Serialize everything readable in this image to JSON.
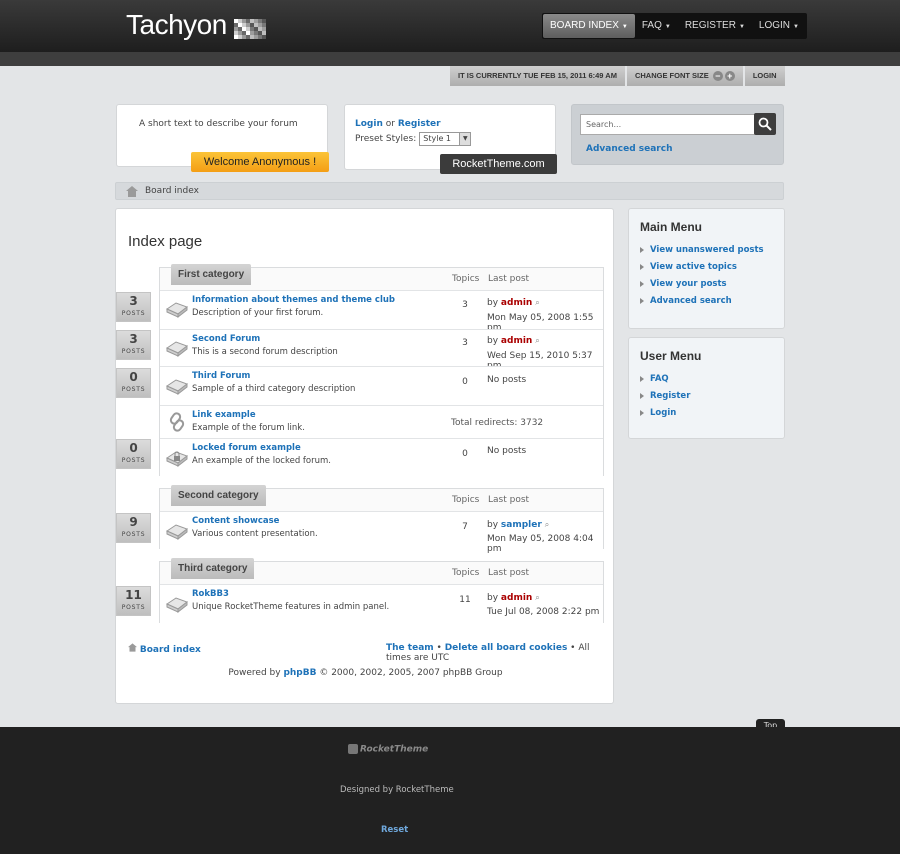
{
  "header": {
    "logo": "Tachyon",
    "nav": [
      {
        "label": "BOARD INDEX",
        "active": true
      },
      {
        "label": "FAQ",
        "active": false
      },
      {
        "label": "REGISTER",
        "active": false
      },
      {
        "label": "LOGIN",
        "active": false
      }
    ]
  },
  "utility": {
    "time_text": "IT IS CURRENTLY TUE FEB 15, 2011 6:49 AM",
    "font_size_label": "CHANGE FONT SIZE",
    "login_label": "LOGIN"
  },
  "intro": {
    "description": "A short text to describe your forum",
    "welcome": "Welcome Anonymous !"
  },
  "login_box": {
    "login_link": "Login",
    "or_text": "or",
    "register_link": "Register",
    "preset_label": "Preset Styles:",
    "preset_value": "Style 1",
    "badge": "RocketTheme.com"
  },
  "search": {
    "placeholder": "Search...",
    "advanced": "Advanced search"
  },
  "breadcrumb": {
    "label": "Board index"
  },
  "page_title": "Index page",
  "headers": {
    "topics": "Topics",
    "last_post": "Last post"
  },
  "labels": {
    "posts": "POSTS",
    "by": "by",
    "no_posts": "No posts",
    "total_redirects": "Total redirects:"
  },
  "categories": [
    {
      "name": "First category",
      "forums": [
        {
          "title": "Information about themes and theme club",
          "desc": "Description of your first forum.",
          "posts": "3",
          "topics": "3",
          "user": "admin",
          "date": "Mon May 05, 2008 1:55 pm"
        },
        {
          "title": "Second Forum",
          "desc": "This is a second forum description",
          "posts": "3",
          "topics": "3",
          "user": "admin",
          "date": "Wed Sep 15, 2010 5:37 pm"
        },
        {
          "title": "Third Forum",
          "desc": "Sample of a third category description",
          "posts": "0",
          "topics": "0"
        },
        {
          "title": "Link example",
          "desc": "Example of the forum link.",
          "redirects": "3732"
        },
        {
          "title": "Locked forum example",
          "desc": "An example of the locked forum.",
          "posts": "0",
          "topics": "0"
        }
      ]
    },
    {
      "name": "Second category",
      "forums": [
        {
          "title": "Content showcase",
          "desc": "Various content presentation.",
          "posts": "9",
          "topics": "7",
          "user": "sampler",
          "date": "Mon May 05, 2008 4:04 pm"
        }
      ]
    },
    {
      "name": "Third category",
      "forums": [
        {
          "title": "RokBB3",
          "desc": "Unique RocketTheme features in admin panel.",
          "posts": "11",
          "topics": "11",
          "user": "admin",
          "date": "Tue Jul 08, 2008 2:22 pm"
        }
      ]
    }
  ],
  "page_footer": {
    "home": "Board index",
    "team": "The team",
    "delete_cookies": "Delete all board cookies",
    "timezone": "All times are UTC",
    "powered_prefix": "Powered by",
    "powered_link": "phpBB",
    "powered_suffix": "© 2000, 2002, 2005, 2007 phpBB Group"
  },
  "main_menu": {
    "title": "Main Menu",
    "items": [
      "View unanswered posts",
      "View active topics",
      "View your posts",
      "Advanced search"
    ]
  },
  "user_menu": {
    "title": "User Menu",
    "items": [
      "FAQ",
      "Register",
      "Login"
    ]
  },
  "site_footer": {
    "top": "Top",
    "logo": "RocketTheme",
    "designed_by": "Designed by RocketTheme",
    "reset": "Reset"
  },
  "colors": {
    "accent": "#1e72b8",
    "user_red": "#aa0000",
    "welcome": "#f49e15",
    "dark": "#212121"
  }
}
